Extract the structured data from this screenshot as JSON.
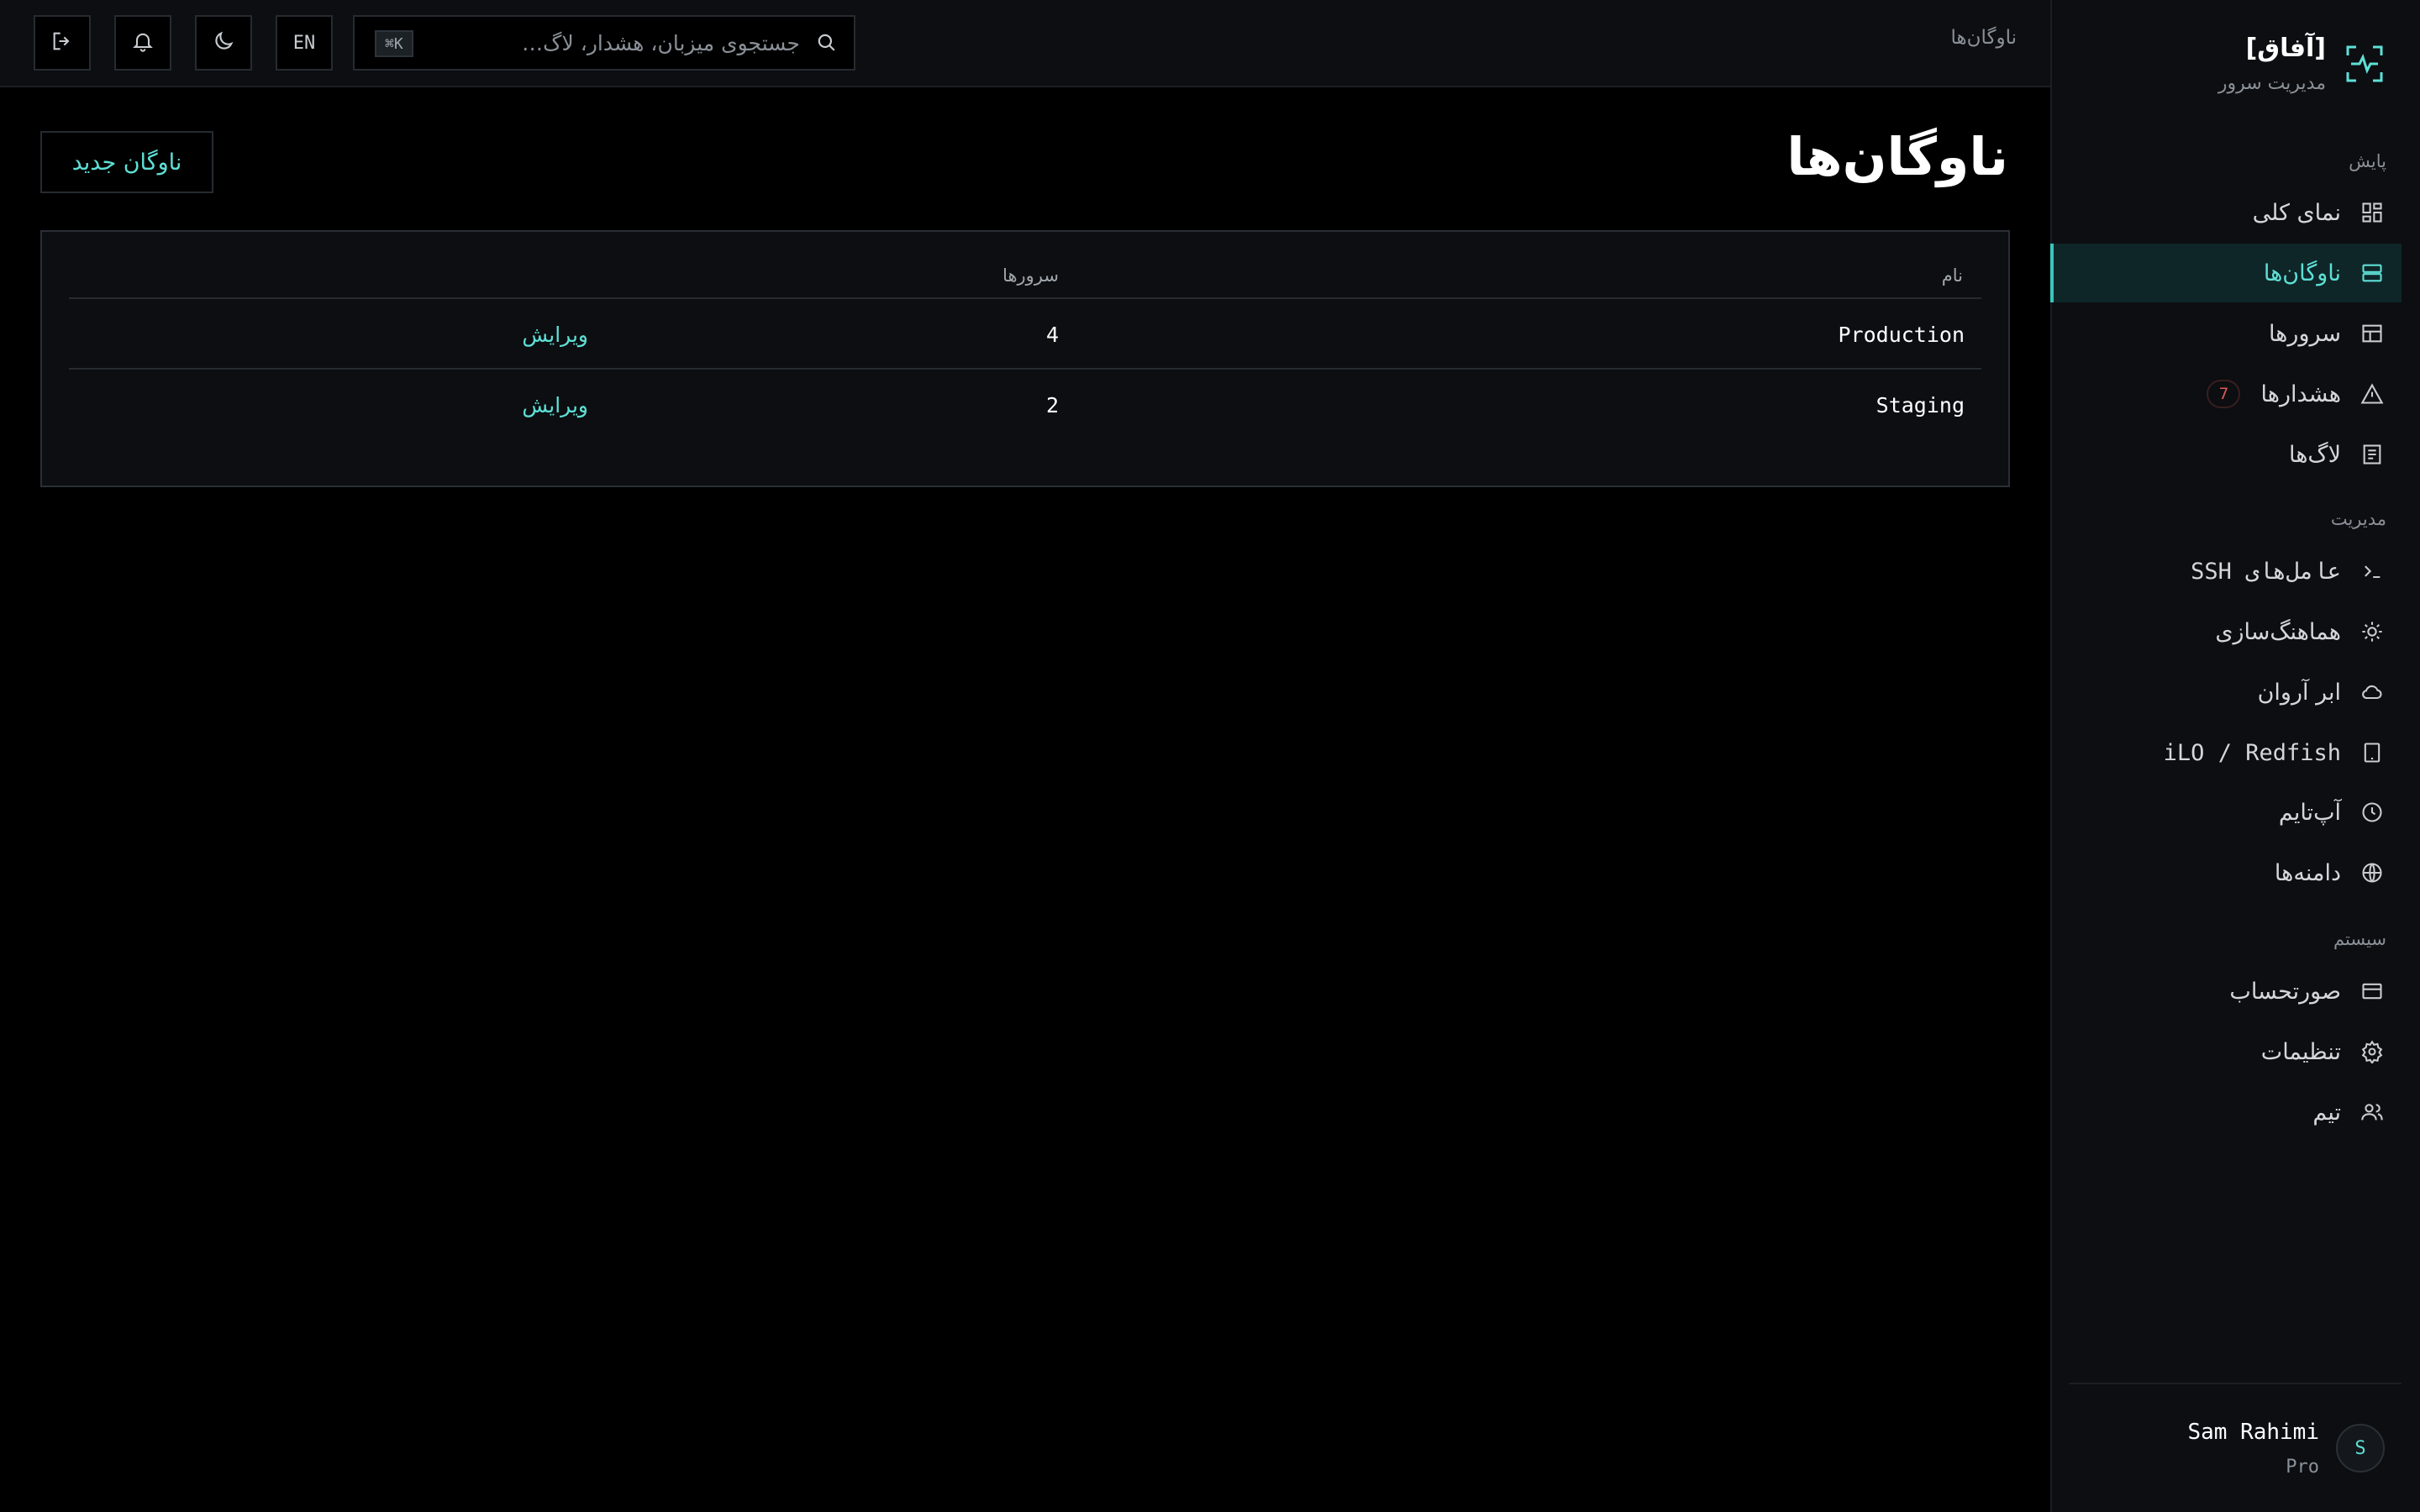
{
  "brand": {
    "name": "[آفاق]",
    "subtitle": "مدیریت سرور"
  },
  "sidebar": {
    "sections": [
      {
        "label": "پایش"
      },
      {
        "label": "مدیریت"
      },
      {
        "label": "سیستم"
      }
    ],
    "items": [
      {
        "label": "نمای کلی",
        "icon": "grid-icon"
      },
      {
        "label": "ناوگان‌ها",
        "icon": "server-stack-icon",
        "active": true
      },
      {
        "label": "سرورها",
        "icon": "table-icon"
      },
      {
        "label": "هشدارها",
        "icon": "warning-icon",
        "badge": "7"
      },
      {
        "label": "لاگ‌ها",
        "icon": "document-icon"
      },
      {
        "label": "عامل‌های SSH",
        "icon": "terminal-icon"
      },
      {
        "label": "هماهنگ‌سازی",
        "icon": "sun-icon"
      },
      {
        "label": "ابر آروان",
        "icon": "cloud-icon"
      },
      {
        "label": "iLO / Redfish",
        "icon": "tablet-icon"
      },
      {
        "label": "آپ‌تایم",
        "icon": "clock-icon"
      },
      {
        "label": "دامنه‌ها",
        "icon": "globe-icon"
      },
      {
        "label": "صورتحساب",
        "icon": "credit-card-icon"
      },
      {
        "label": "تنظیمات",
        "icon": "gear-icon"
      },
      {
        "label": "تیم",
        "icon": "users-icon"
      }
    ]
  },
  "user": {
    "name": "Sam Rahimi",
    "plan": "Pro",
    "initial": "S"
  },
  "header": {
    "breadcrumb": "ناوگان‌ها",
    "search_placeholder": "جستجوی میزبان، هشدار، لاگ…",
    "search_shortcut": "⌘K",
    "lang_label": "EN"
  },
  "main": {
    "title": "ناوگان‌ها",
    "new_button": "ناوگان جدید",
    "table": {
      "columns": [
        "نام",
        "سرورها"
      ],
      "rows": [
        {
          "name": "Production",
          "servers": "4",
          "action": "ویرایش"
        },
        {
          "name": "Staging",
          "servers": "2",
          "action": "ویرایش"
        }
      ]
    }
  },
  "colors": {
    "accent": "#5ee0d6",
    "background": "#000000",
    "panel": "#0c0e11",
    "alert": "#e05b5b"
  }
}
